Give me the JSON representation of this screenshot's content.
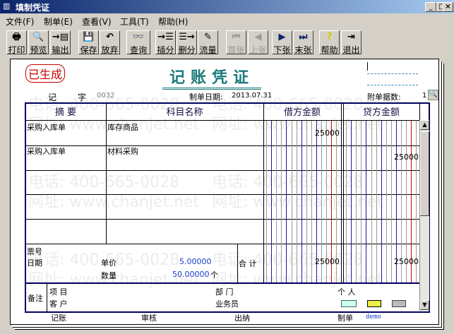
{
  "window": {
    "title": "填制凭证",
    "min": "_",
    "max": "□",
    "close": "×"
  },
  "menu": [
    "文件(F)",
    "制单(E)",
    "查看(V)",
    "工具(T)",
    "帮助(H)"
  ],
  "toolbar": [
    {
      "label": "打印",
      "icon": "printer-icon",
      "glyph": "🖶"
    },
    {
      "label": "预览",
      "icon": "preview-icon",
      "glyph": "🔍"
    },
    {
      "label": "输出",
      "icon": "export-icon",
      "glyph": "→▤"
    },
    {
      "label": "保存",
      "icon": "save-icon",
      "glyph": "💾"
    },
    {
      "label": "放弃",
      "icon": "undo-icon",
      "glyph": "↶"
    },
    {
      "label": "查询",
      "icon": "binoculars-icon",
      "glyph": "👓"
    },
    {
      "label": "插分",
      "icon": "insert-row-icon",
      "glyph": "→☰"
    },
    {
      "label": "删分",
      "icon": "delete-row-icon",
      "glyph": "☰→"
    },
    {
      "label": "流量",
      "icon": "notepad-icon",
      "glyph": "✎"
    },
    {
      "label": "首张",
      "icon": "first-icon",
      "glyph": "⏮"
    },
    {
      "label": "上张",
      "icon": "prev-icon",
      "glyph": "◀"
    },
    {
      "label": "下张",
      "icon": "next-icon",
      "glyph": "▶"
    },
    {
      "label": "末张",
      "icon": "last-icon",
      "glyph": "⏭"
    },
    {
      "label": "帮助",
      "icon": "help-icon",
      "glyph": "?"
    },
    {
      "label": "退出",
      "icon": "exit-icon",
      "glyph": "⇥"
    }
  ],
  "watermark": {
    "phone": "电话: 400-665-0028",
    "site": "网址: www.chanjet.net"
  },
  "voucher": {
    "stamp": "已生成",
    "title": "记账凭证",
    "type_label": "记",
    "zi_label": "字",
    "number": "0032",
    "date_label": "制单日期:",
    "date": "2013.07.31",
    "attach_label": "附单据数:",
    "attach_count": "1",
    "headers": [
      "摘 要",
      "科目名称",
      "借方金额",
      "贷方金额"
    ],
    "rows": [
      {
        "summary": "采购入库单",
        "account": "库存商品",
        "debit": "25000",
        "credit": ""
      },
      {
        "summary": "采购入库单",
        "account": "材料采购",
        "debit": "",
        "credit": "25000"
      }
    ],
    "ticket_label": "票号",
    "date2_label": "日期",
    "price_label": "单价",
    "price": "5.00000",
    "qty_label": "数量",
    "qty": "50.00000",
    "unit": "个",
    "total_label": "合 计",
    "total_debit": "25000",
    "total_credit": "25000",
    "remark_label": "备注",
    "project_label": "项 目",
    "customer_label": "客 户",
    "dept_label": "部 门",
    "salesman_label": "业务员",
    "person_label": "个 人",
    "sign": {
      "bookkeep": "记账",
      "audit": "审核",
      "cashier": "出纳",
      "maker_label": "制单",
      "maker": "demo"
    }
  }
}
